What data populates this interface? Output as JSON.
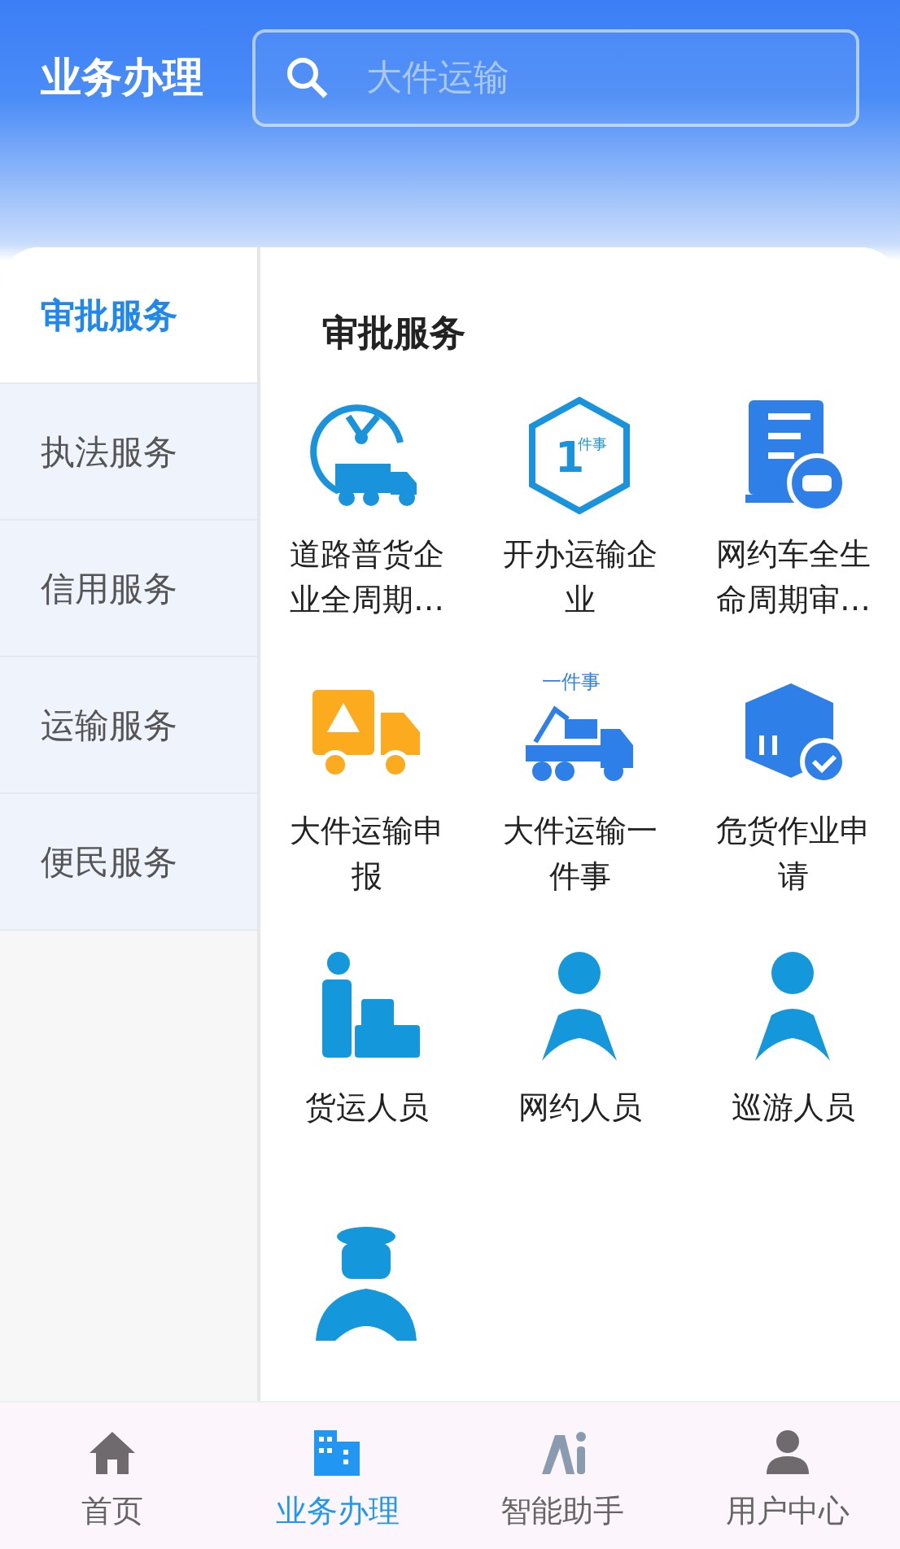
{
  "header": {
    "title": "业务办理",
    "search": {
      "placeholder": "大件运输"
    }
  },
  "sidebar": {
    "items": [
      {
        "label": "审批服务",
        "selected": true
      },
      {
        "label": "执法服务",
        "selected": false
      },
      {
        "label": "信用服务",
        "selected": false
      },
      {
        "label": "运输服务",
        "selected": false
      },
      {
        "label": "便民服务",
        "selected": false
      }
    ]
  },
  "section": {
    "title": "审批服务",
    "items": [
      {
        "kind": "clock",
        "label": "道路普货企业全周期…"
      },
      {
        "kind": "hexagon",
        "label": "开办运输企业",
        "icon_text": "1",
        "icon_caption": "件事"
      },
      {
        "kind": "document",
        "label": "网约车全生命周期审…"
      },
      {
        "kind": "warning",
        "label": "大件运输申报"
      },
      {
        "kind": "excavator",
        "label": "大件运输一件事",
        "icon_caption": "一件事"
      },
      {
        "kind": "box",
        "label": "危货作业申请"
      },
      {
        "kind": "porter",
        "label": "货运人员"
      },
      {
        "kind": "driver",
        "label": "网约人员"
      },
      {
        "kind": "driver",
        "label": "巡游人员"
      },
      {
        "kind": "captain"
      }
    ]
  },
  "tabbar": [
    {
      "label": "首页",
      "selected": false
    },
    {
      "label": "业务办理",
      "selected": true
    },
    {
      "label": "智能助手",
      "selected": false
    },
    {
      "label": "用户中心",
      "selected": false
    }
  ]
}
